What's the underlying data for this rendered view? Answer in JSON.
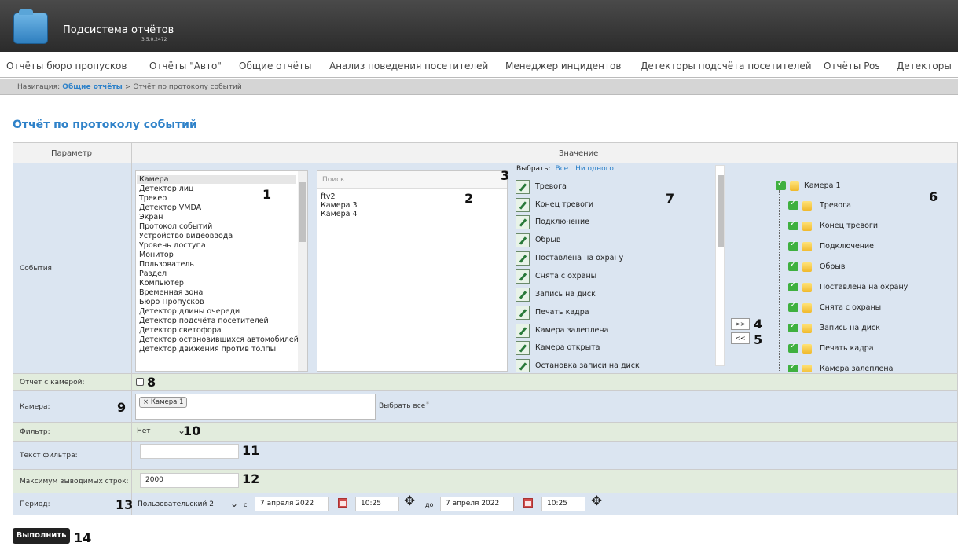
{
  "header": {
    "title": "Подсистема отчётов",
    "version": "3.5.0.2472"
  },
  "menu": [
    "Отчёты бюро пропусков",
    "Отчёты \"Авто\"",
    "Общие отчёты",
    "Анализ поведения посетителей",
    "Менеджер инцидентов",
    "Детекторы подсчёта посетителей",
    "Отчёты Pos",
    "Детекторы"
  ],
  "breadcrumb": {
    "prefix": "Навигация:",
    "link": "Общие отчёты",
    "suffix": "> Отчёт по протоколу событий"
  },
  "page_title": "Отчёт по протоколу событий",
  "table_head": {
    "param": "Параметр",
    "value": "Значение"
  },
  "events": {
    "label": "События:",
    "object_types": [
      "Камера",
      "Детектор лиц",
      "Трекер",
      "Детектор VMDA",
      "Экран",
      "Протокол событий",
      "Устройство видеоввода",
      "Уровень доступа",
      "Монитор",
      "Пользователь",
      "Раздел",
      "Компьютер",
      "Временная зона",
      "Бюро Пропусков",
      "Детектор длины очереди",
      "Детектор подсчёта посетителей",
      "Детектор светофора",
      "Детектор остановившихся автомобилей",
      "Детектор движения против толпы"
    ],
    "search_placeholder": "Поиск",
    "objects": [
      "ftv2",
      "Камера 3",
      "Камера 4"
    ],
    "select_prefix": "Выбрать:",
    "select_all": "Все",
    "select_none": "Ни одного",
    "event_types": [
      "Тревога",
      "Конец тревоги",
      "Подключение",
      "Обрыв",
      "Поставлена на охрану",
      "Снята с охраны",
      "Запись на диск",
      "Печать кадра",
      "Камера залеплена",
      "Камера открыта",
      "Остановка записи на диск"
    ],
    "add_btn": ">>",
    "remove_btn": "<<",
    "tree_root": "Камера 1",
    "tree_items": [
      "Тревога",
      "Конец тревоги",
      "Подключение",
      "Обрыв",
      "Поставлена на охрану",
      "Снята с охраны",
      "Запись на диск",
      "Печать кадра",
      "Камера залеплена"
    ]
  },
  "camera_report": {
    "label": "Отчёт с камерой:"
  },
  "camera": {
    "label": "Камера:",
    "tag": "× Камера 1",
    "select_all": "Выбрать все",
    "asterisk": "*"
  },
  "filter": {
    "label": "Фильтр:",
    "value": "Нет"
  },
  "filter_text": {
    "label": "Текст фильтра:",
    "value": ""
  },
  "max_rows": {
    "label": "Максимум выводимых строк:",
    "value": "2000"
  },
  "period": {
    "label": "Период:",
    "preset": "Пользовательский 2",
    "from_prefix": "с",
    "from_date": "7 апреля 2022",
    "from_time": "10:25",
    "to_prefix": "до",
    "to_date": "7 апреля 2022",
    "to_time": "10:25"
  },
  "run_button": "Выполнить",
  "callouts": [
    "1",
    "2",
    "3",
    "4",
    "5",
    "6",
    "7",
    "8",
    "9",
    "10",
    "11",
    "12",
    "13",
    "14"
  ]
}
